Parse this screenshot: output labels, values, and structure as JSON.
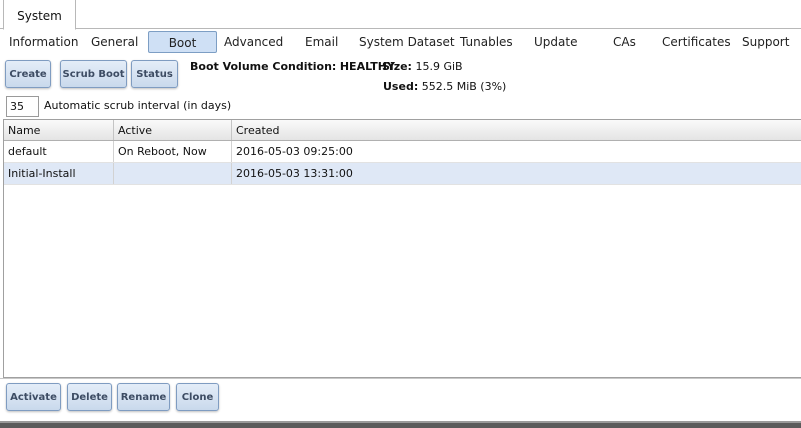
{
  "window": {
    "tab_label": "System"
  },
  "subnav": {
    "items": [
      {
        "label": "Information"
      },
      {
        "label": "General"
      },
      {
        "label": "Boot"
      },
      {
        "label": "Advanced"
      },
      {
        "label": "Email"
      },
      {
        "label": "System Dataset"
      },
      {
        "label": "Tunables"
      },
      {
        "label": "Update"
      },
      {
        "label": "CAs"
      },
      {
        "label": "Certificates"
      },
      {
        "label": "Support"
      }
    ],
    "active": "Boot"
  },
  "toolbar": {
    "create_label": "Create",
    "scrub_boot_label": "Scrub Boot",
    "status_label": "Status"
  },
  "boot_info": {
    "condition_label": "Boot Volume Condition:",
    "condition_value": "HEALTHY",
    "size_label": "Size:",
    "size_value": "15.9 GiB",
    "used_label": "Used:",
    "used_value": "552.5 MiB (3%)"
  },
  "scrub": {
    "interval_value": "35",
    "interval_label": "Automatic scrub interval (in days)"
  },
  "table": {
    "columns": [
      "Name",
      "Active",
      "Created"
    ],
    "rows": [
      {
        "name": "default",
        "active": "On Reboot, Now",
        "created": "2016-05-03 09:25:00"
      },
      {
        "name": "Initial-Install",
        "active": "",
        "created": "2016-05-03 13:31:00"
      }
    ],
    "selected_row": 1
  },
  "actions": {
    "activate_label": "Activate",
    "delete_label": "Delete",
    "rename_label": "Rename",
    "clone_label": "Clone"
  }
}
